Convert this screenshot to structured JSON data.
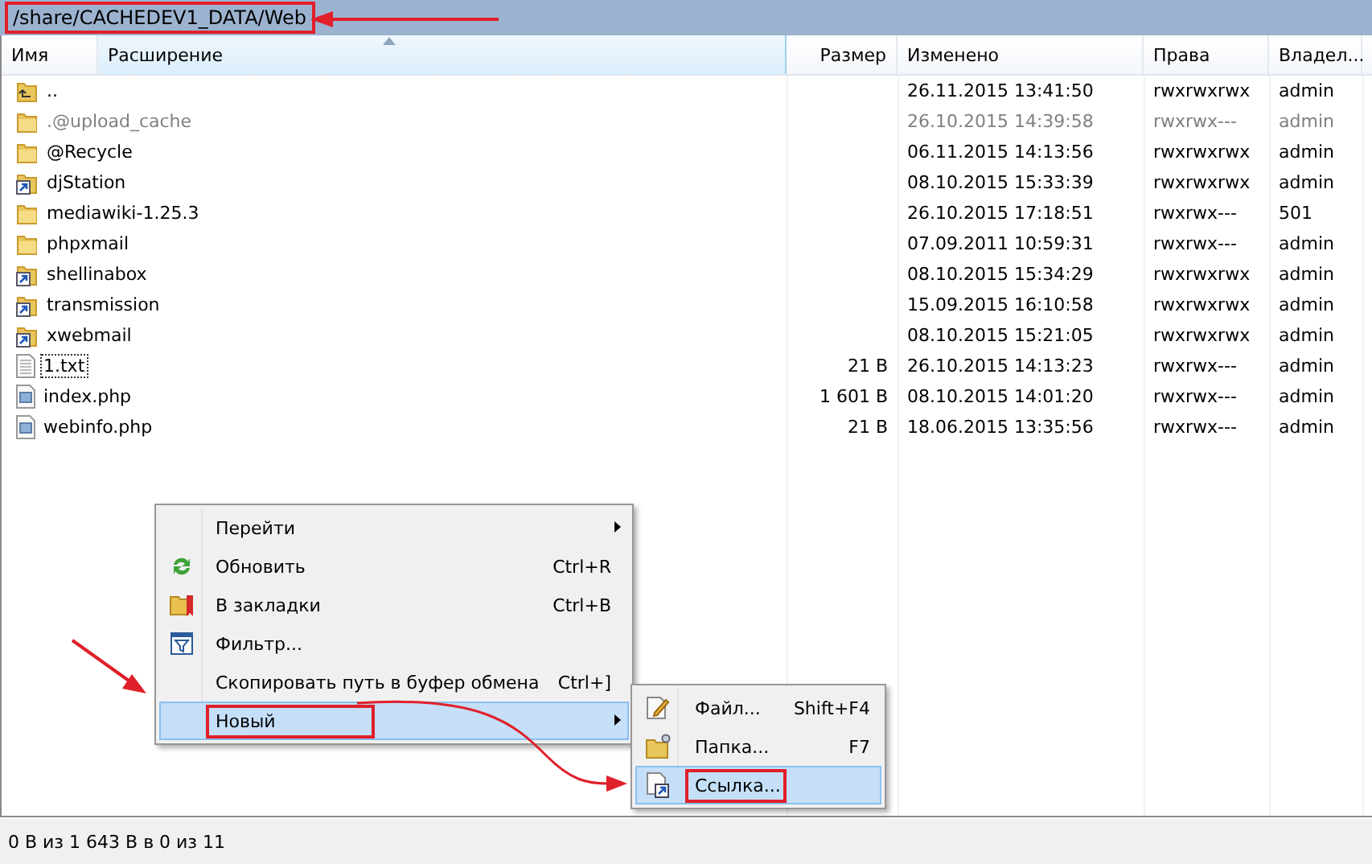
{
  "path_bar": {
    "path": "/share/CACHEDEV1_DATA/Web",
    "annotated": true
  },
  "columns": [
    {
      "label": "Имя",
      "sorted": false
    },
    {
      "label": "Расширение",
      "sorted": true
    },
    {
      "label": "Размер",
      "sorted": false
    },
    {
      "label": "Изменено",
      "sorted": false
    },
    {
      "label": "Права",
      "sorted": false
    },
    {
      "label": "Владел...",
      "sorted": false
    }
  ],
  "rows": [
    {
      "kind": "parent",
      "name": "..",
      "size": "",
      "modified": "26.11.2015 13:41:50",
      "rights": "rwxrwxrwx",
      "owner": "admin",
      "dimmed": false,
      "focused": false
    },
    {
      "kind": "folder",
      "name": ".@upload_cache",
      "modified": "26.10.2015 14:39:58",
      "rights": "rwxrwx---",
      "owner": "admin",
      "dimmed": true,
      "focused": false
    },
    {
      "kind": "folder",
      "name": "@Recycle",
      "modified": "06.11.2015 14:13:56",
      "rights": "rwxrwxrwx",
      "owner": "admin",
      "dimmed": false,
      "focused": false
    },
    {
      "kind": "link",
      "name": "djStation",
      "modified": "08.10.2015 15:33:39",
      "rights": "rwxrwxrwx",
      "owner": "admin",
      "dimmed": false,
      "focused": false
    },
    {
      "kind": "folder",
      "name": "mediawiki-1.25.3",
      "modified": "26.10.2015 17:18:51",
      "rights": "rwxrwx---",
      "owner": "501",
      "dimmed": false,
      "focused": false
    },
    {
      "kind": "folder",
      "name": "phpxmail",
      "modified": "07.09.2011 10:59:31",
      "rights": "rwxrwx---",
      "owner": "admin",
      "dimmed": false,
      "focused": false
    },
    {
      "kind": "link",
      "name": "shellinabox",
      "modified": "08.10.2015 15:34:29",
      "rights": "rwxrwxrwx",
      "owner": "admin",
      "dimmed": false,
      "focused": false
    },
    {
      "kind": "link",
      "name": "transmission",
      "modified": "15.09.2015 16:10:58",
      "rights": "rwxrwxrwx",
      "owner": "admin",
      "dimmed": false,
      "focused": false
    },
    {
      "kind": "link",
      "name": "xwebmail",
      "modified": "08.10.2015 15:21:05",
      "rights": "rwxrwxrwx",
      "owner": "admin",
      "dimmed": false,
      "focused": false
    },
    {
      "kind": "text",
      "name": "1.txt",
      "size": "21 B",
      "modified": "26.10.2015 14:13:23",
      "rights": "rwxrwx---",
      "owner": "admin",
      "dimmed": false,
      "focused": true
    },
    {
      "kind": "script",
      "name": "index.php",
      "size": "1 601 B",
      "modified": "08.10.2015 14:01:20",
      "rights": "rwxrwx---",
      "owner": "admin",
      "dimmed": false,
      "focused": false
    },
    {
      "kind": "script",
      "name": "webinfo.php",
      "size": "21 B",
      "modified": "18.06.2015 13:35:56",
      "rights": "rwxrwx---",
      "owner": "admin",
      "dimmed": false,
      "focused": false
    }
  ],
  "context_menu": {
    "items": [
      {
        "kind": "plain",
        "label": "Перейти",
        "submenu": true,
        "selected": false,
        "annotated": false
      },
      {
        "kind": "refresh",
        "label": "Обновить",
        "shortcut": "Ctrl+R",
        "submenu": false,
        "selected": false,
        "annotated": false
      },
      {
        "kind": "bookmark",
        "label": "В закладки",
        "shortcut": "Ctrl+B",
        "submenu": false,
        "selected": false,
        "annotated": false
      },
      {
        "kind": "filter",
        "label": "Фильтр...",
        "submenu": false,
        "selected": false,
        "annotated": false
      },
      {
        "kind": "plain",
        "label": "Скопировать путь в буфер обмена",
        "shortcut": "Ctrl+]",
        "submenu": false,
        "selected": false,
        "annotated": false
      },
      {
        "kind": "plain",
        "label": "Новый",
        "submenu": true,
        "selected": true,
        "annotated": true
      }
    ]
  },
  "submenu": {
    "items": [
      {
        "kind": "new-file",
        "label": "Файл...",
        "shortcut": "Shift+F4",
        "selected": false,
        "annotated": false
      },
      {
        "kind": "new-folder",
        "label": "Папка...",
        "shortcut": "F7",
        "selected": false,
        "annotated": false
      },
      {
        "kind": "link",
        "label": "Ссылка...",
        "selected": true,
        "annotated": true
      }
    ]
  },
  "status_bar": {
    "text": "0 B из 1 643 B в 0 из 11"
  }
}
